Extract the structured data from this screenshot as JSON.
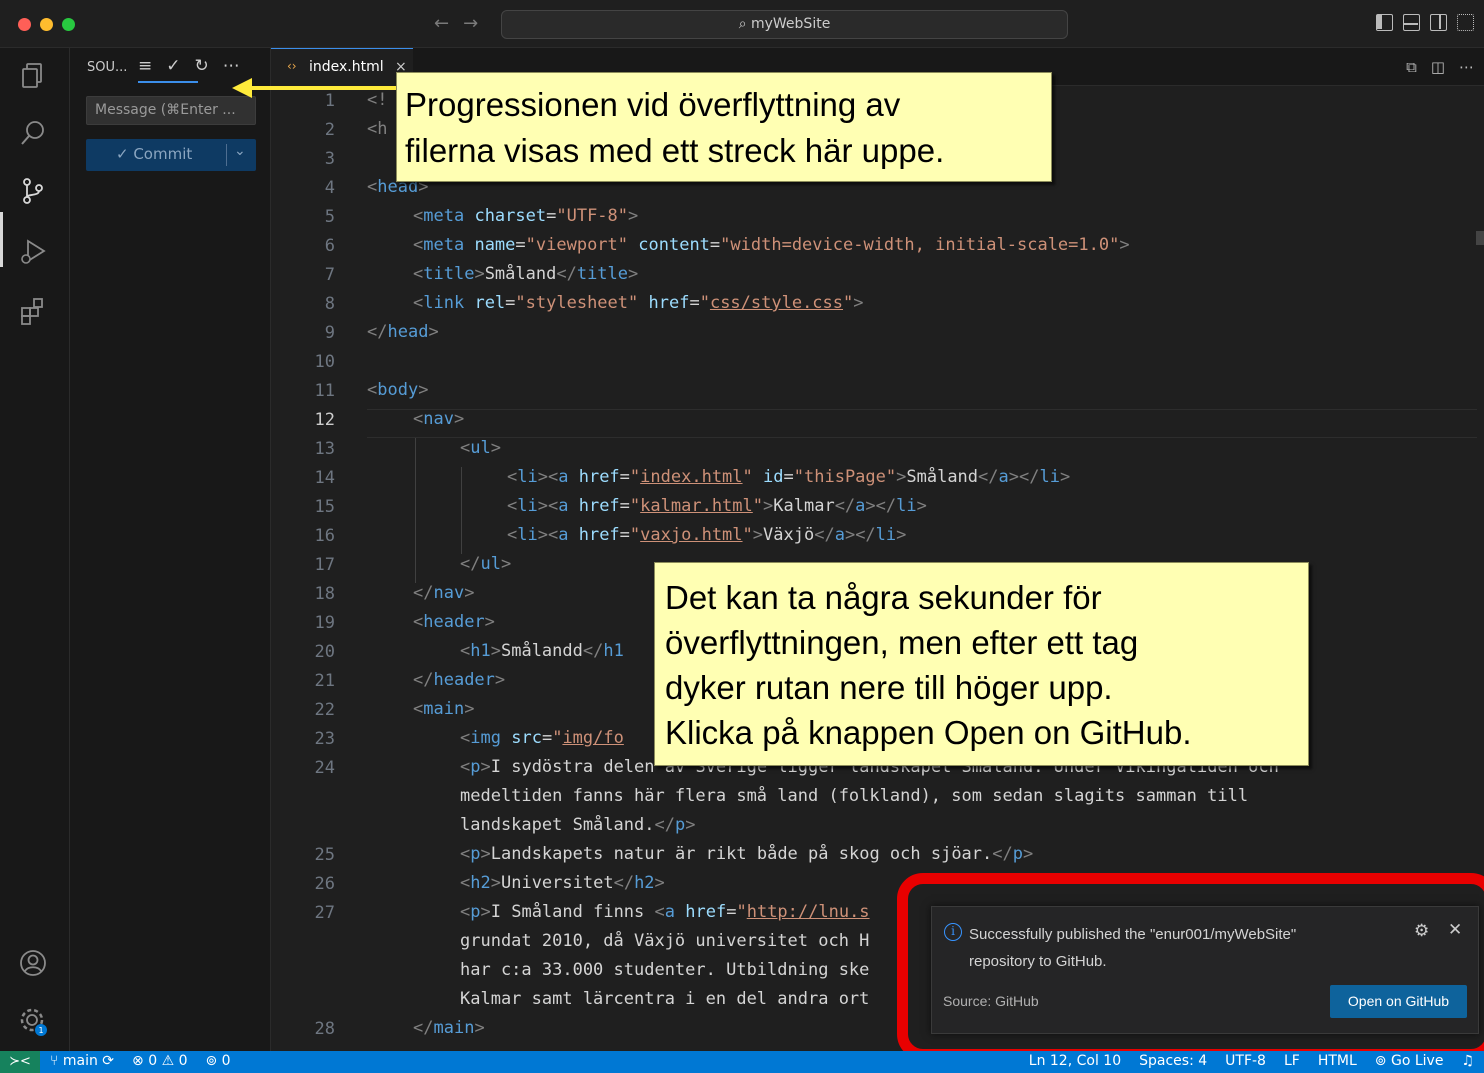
{
  "window": {
    "title": "myWebSite",
    "traffic_colors": [
      "#ff5f57",
      "#febc2e",
      "#28c840"
    ]
  },
  "sidebar": {
    "title": "SOU...",
    "message_placeholder": "Message (⌘Enter ...",
    "commit_label": "✓ Commit"
  },
  "tab": {
    "name": "index.html",
    "close": "×"
  },
  "editor": {
    "current_line": 12,
    "lines": [
      {
        "n": "1",
        "t": 0
      },
      {
        "n": "2",
        "t": 0
      },
      {
        "n": "3",
        "t": 0
      },
      {
        "n": "4",
        "t": 0
      },
      {
        "n": "5",
        "t": 0
      },
      {
        "n": "6",
        "t": 0
      },
      {
        "n": "7",
        "t": 0
      },
      {
        "n": "8",
        "t": 0
      },
      {
        "n": "9",
        "t": 0
      },
      {
        "n": "10",
        "t": 0
      },
      {
        "n": "11",
        "t": 0
      },
      {
        "n": "12",
        "t": 0
      },
      {
        "n": "13",
        "t": 0
      },
      {
        "n": "14",
        "t": 0
      },
      {
        "n": "15",
        "t": 0
      },
      {
        "n": "16",
        "t": 0
      },
      {
        "n": "17",
        "t": 0
      },
      {
        "n": "18",
        "t": 0
      },
      {
        "n": "19",
        "t": 0
      },
      {
        "n": "20",
        "t": 0
      },
      {
        "n": "21",
        "t": 0
      },
      {
        "n": "22",
        "t": 0
      },
      {
        "n": "23",
        "t": 0
      },
      {
        "n": "24",
        "t": 0
      },
      {
        "n": "",
        "t": 0
      },
      {
        "n": "",
        "t": 0
      },
      {
        "n": "25",
        "t": 0
      },
      {
        "n": "26",
        "t": 0
      },
      {
        "n": "27",
        "t": 0
      },
      {
        "n": "",
        "t": 0
      },
      {
        "n": "",
        "t": 0
      },
      {
        "n": "",
        "t": 0
      },
      {
        "n": "28",
        "t": 0
      }
    ],
    "text": {
      "l1": "<!",
      "l2": "<h",
      "l4_tag": "head",
      "l5_charset": "\"UTF-8\"",
      "l6_name": "\"viewport\"",
      "l6_content": "\"width=device-width, initial-scale=1.0\"",
      "l7_title": "Småland",
      "l8_href": "css/style.css",
      "l14_href": "index.html",
      "l14_id": "\"thisPage\"",
      "l14_text": "Småland",
      "l15_href": "kalmar.html",
      "l15_text": "Kalmar",
      "l16_href": "vaxjo.html",
      "l16_text": "Växjö",
      "l20_text": "Smålandd",
      "l23_src": "img/fo",
      "l24a": "I sydöstra delen av Sverige ligger landskapet Småland. Under Vikingatiden och",
      "l24b": "medeltiden fanns här flera små land (folkland), som sedan slagits samman till",
      "l24c": "landskapet Småland.",
      "l25": "Landskapets natur är rikt både på skog och sjöar.",
      "l26": "Universitet",
      "l27_pre": "I Småland finns ",
      "l27_href": "http://lnu.s",
      "l27b": "grundat 2010, då Växjö universitet och H",
      "l27c": "har c:a 33.000 studenter. Utbildning ske",
      "l27d": "Kalmar samt lärcentra i en del andra ort"
    }
  },
  "callouts": {
    "top": [
      "Progressionen vid överflyttning av",
      "filerna visas med ett streck här uppe."
    ],
    "middle": [
      "Det kan ta några sekunder för",
      "överflyttningen, men efter ett tag",
      "dyker rutan nere till höger upp.",
      "Klicka på knappen Open on GitHub."
    ]
  },
  "notification": {
    "message_line1": "Successfully published the \"enur001/myWebSite\"",
    "message_line2": "repository to GitHub.",
    "source": "Source: GitHub",
    "button": "Open on GitHub"
  },
  "statusbar": {
    "branch": "main",
    "problems": "⊗ 0 ⚠ 0",
    "ports": "0",
    "position": "Ln 12, Col 10",
    "spaces": "Spaces: 4",
    "encoding": "UTF-8",
    "eol": "LF",
    "language": "HTML",
    "golive": "Go Live"
  }
}
